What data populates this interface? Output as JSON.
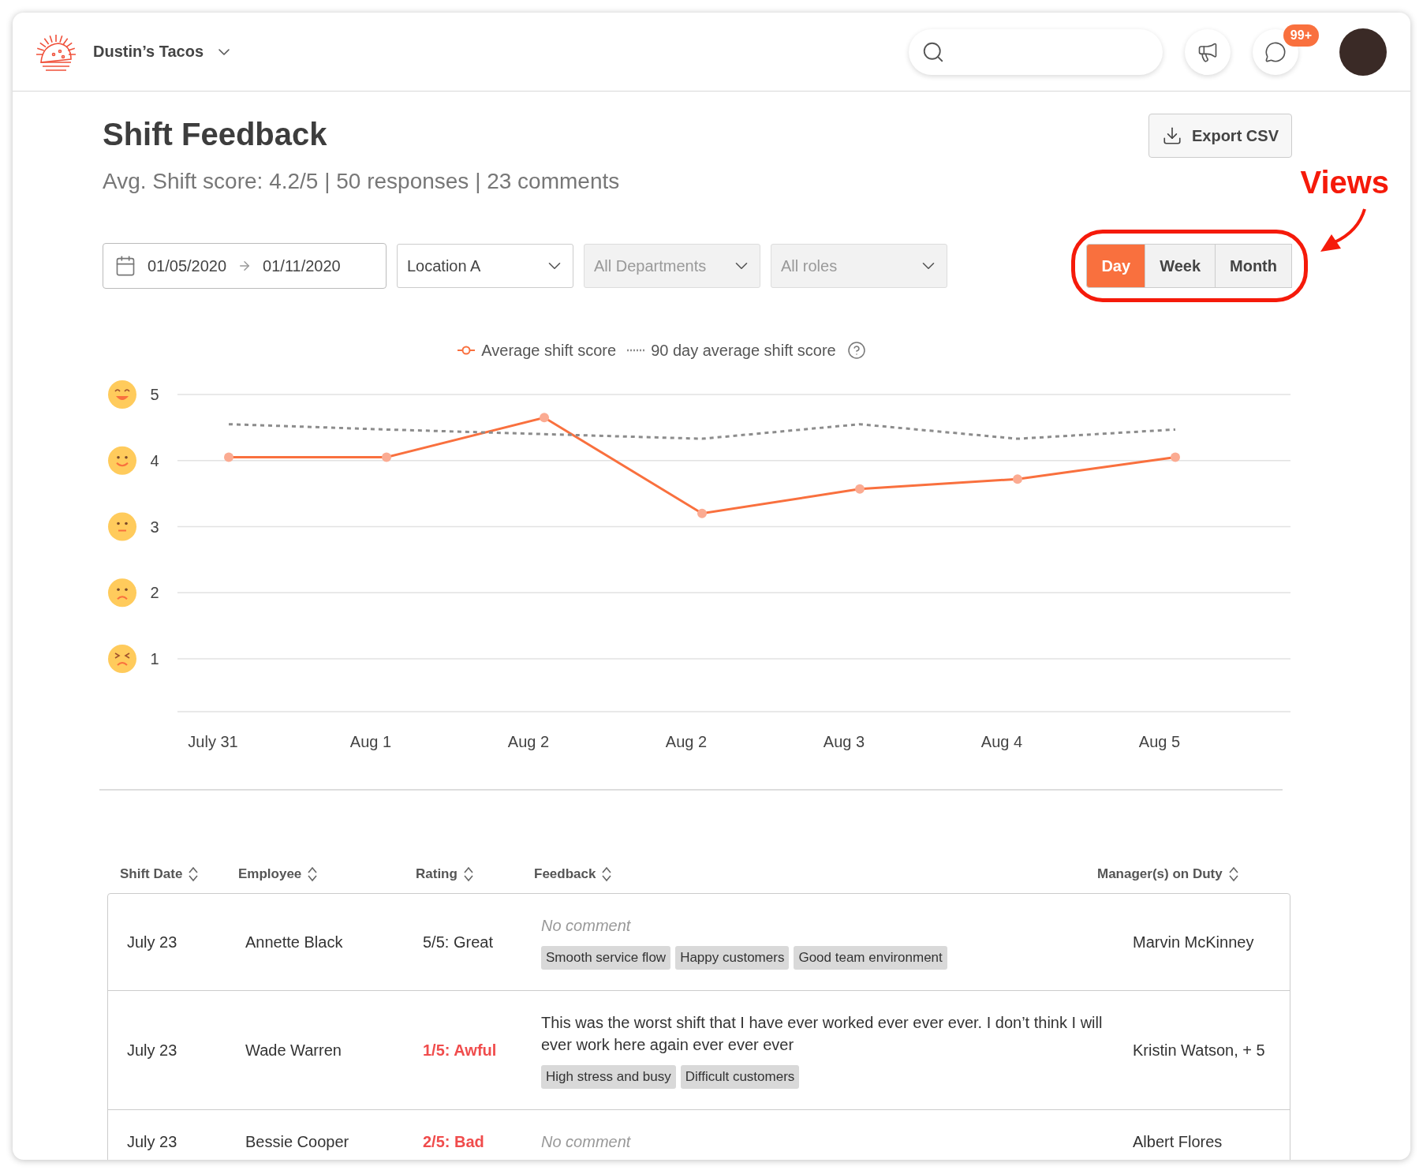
{
  "header": {
    "brand": "Dustin’s Tacos",
    "messages_badge": "99+"
  },
  "page": {
    "title": "Shift Feedback",
    "summary": "Avg. Shift score: 4.2/5 | 50 responses | 23 comments",
    "export_button": "Export CSV"
  },
  "filters": {
    "date_start": "01/05/2020",
    "date_end": "01/11/2020",
    "selects": [
      {
        "value": "Location A",
        "disabled": false
      },
      {
        "value": "All Departments",
        "disabled": true
      },
      {
        "value": "All roles",
        "disabled": true
      }
    ]
  },
  "views": [
    {
      "label": "Day",
      "selected": true
    },
    {
      "label": "Week",
      "selected": false
    },
    {
      "label": "Month",
      "selected": false
    }
  ],
  "annotation": {
    "text": "Views"
  },
  "chart": {
    "chart_data": {
      "type": "line",
      "categories": [
        "July 31",
        "Aug 1",
        "Aug 2",
        "Aug 2",
        "Aug 3",
        "Aug 4",
        "Aug 5"
      ],
      "series": [
        {
          "name": "Average shift score",
          "color": "#f9703e",
          "values": [
            4.05,
            4.05,
            4.65,
            3.2,
            3.57,
            3.72,
            4.05
          ],
          "marker": "circle",
          "line_style": "solid"
        },
        {
          "name": "90 day average shift score",
          "color": "#8c8c8c",
          "values": [
            4.55,
            4.47,
            4.4,
            4.33,
            4.55,
            4.33,
            4.47
          ],
          "marker": "none",
          "line_style": "dashed"
        }
      ],
      "ylim": [
        0.2,
        5
      ],
      "yticks": [
        1,
        2,
        3,
        4,
        5
      ],
      "grid": true
    }
  },
  "table": {
    "columns": [
      "Shift Date",
      "Employee",
      "Rating",
      "Feedback",
      "Manager(s) on Duty"
    ],
    "rows": [
      {
        "date": "July 23",
        "employee": "Annette Black",
        "rating": "5/5: Great",
        "negative": false,
        "feedback": {
          "kind": "none",
          "text": "No comment"
        },
        "tags": [
          "Smooth service flow",
          "Happy customers",
          "Good team environment"
        ],
        "managers": "Marvin McKinney"
      },
      {
        "date": "July 23",
        "employee": "Wade Warren",
        "rating": "1/5: Awful",
        "negative": true,
        "feedback": {
          "kind": "comment",
          "text": "This was the worst shift that I have ever worked ever ever ever. I don’t think I will ever work here again ever ever ever"
        },
        "tags": [
          "High stress and busy",
          "Difficult customers"
        ],
        "managers": "Kristin Watson, + 5"
      },
      {
        "date": "July 23",
        "employee": "Bessie Cooper",
        "rating": "2/5: Bad",
        "negative": true,
        "feedback": {
          "kind": "none",
          "text": "No comment"
        },
        "tags": [],
        "managers": "Albert Flores"
      }
    ]
  }
}
